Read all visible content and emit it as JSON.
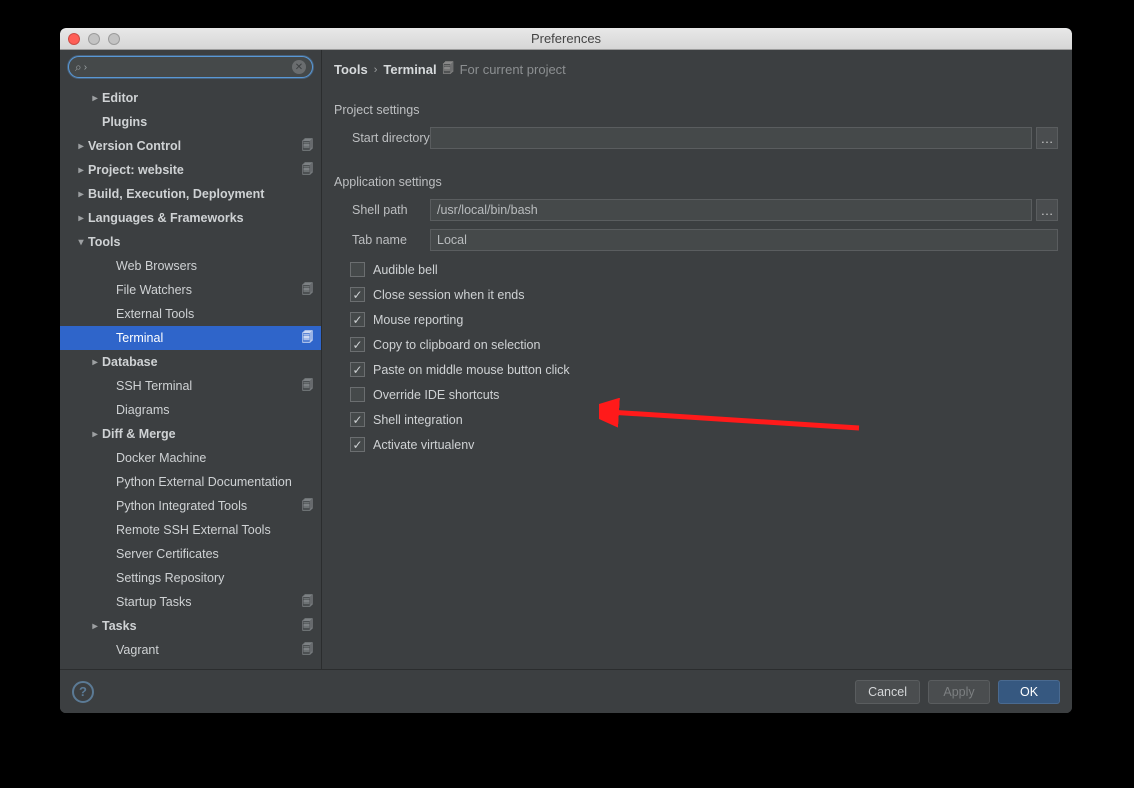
{
  "window": {
    "title": "Preferences"
  },
  "search": {
    "placeholder": ""
  },
  "sidebar": {
    "items": [
      {
        "label": "Editor",
        "indent": 1,
        "twisty": "right",
        "badge": false
      },
      {
        "label": "Plugins",
        "indent": 1,
        "twisty": "",
        "badge": false
      },
      {
        "label": "Version Control",
        "indent": 0,
        "twisty": "right",
        "badge": true
      },
      {
        "label": "Project: website",
        "indent": 0,
        "twisty": "right",
        "badge": true
      },
      {
        "label": "Build, Execution, Deployment",
        "indent": 0,
        "twisty": "right",
        "badge": false
      },
      {
        "label": "Languages & Frameworks",
        "indent": 0,
        "twisty": "right",
        "badge": false
      },
      {
        "label": "Tools",
        "indent": 0,
        "twisty": "down",
        "badge": false
      },
      {
        "label": "Web Browsers",
        "indent": 2,
        "twisty": "",
        "badge": false,
        "child": true
      },
      {
        "label": "File Watchers",
        "indent": 2,
        "twisty": "",
        "badge": true,
        "child": true
      },
      {
        "label": "External Tools",
        "indent": 2,
        "twisty": "",
        "badge": false,
        "child": true
      },
      {
        "label": "Terminal",
        "indent": 2,
        "twisty": "",
        "badge": true,
        "selected": true,
        "child": true
      },
      {
        "label": "Database",
        "indent": 1,
        "twisty": "right",
        "badge": false
      },
      {
        "label": "SSH Terminal",
        "indent": 2,
        "twisty": "",
        "badge": true,
        "child": true
      },
      {
        "label": "Diagrams",
        "indent": 2,
        "twisty": "",
        "badge": false,
        "child": true
      },
      {
        "label": "Diff & Merge",
        "indent": 1,
        "twisty": "right",
        "badge": false
      },
      {
        "label": "Docker Machine",
        "indent": 2,
        "twisty": "",
        "badge": false,
        "child": true
      },
      {
        "label": "Python External Documentation",
        "indent": 2,
        "twisty": "",
        "badge": false,
        "child": true
      },
      {
        "label": "Python Integrated Tools",
        "indent": 2,
        "twisty": "",
        "badge": true,
        "child": true
      },
      {
        "label": "Remote SSH External Tools",
        "indent": 2,
        "twisty": "",
        "badge": false,
        "child": true
      },
      {
        "label": "Server Certificates",
        "indent": 2,
        "twisty": "",
        "badge": false,
        "child": true
      },
      {
        "label": "Settings Repository",
        "indent": 2,
        "twisty": "",
        "badge": false,
        "child": true
      },
      {
        "label": "Startup Tasks",
        "indent": 2,
        "twisty": "",
        "badge": true,
        "child": true
      },
      {
        "label": "Tasks",
        "indent": 1,
        "twisty": "right",
        "badge": true
      },
      {
        "label": "Vagrant",
        "indent": 2,
        "twisty": "",
        "badge": true,
        "child": true
      }
    ]
  },
  "breadcrumb": {
    "root": "Tools",
    "leaf": "Terminal",
    "scope": "For current project"
  },
  "project_settings": {
    "heading": "Project settings",
    "start_directory_label": "Start directory",
    "start_directory_value": ""
  },
  "app_settings": {
    "heading": "Application settings",
    "shell_path_label": "Shell path",
    "shell_path_value": "/usr/local/bin/bash",
    "tab_name_label": "Tab name",
    "tab_name_value": "Local",
    "checkboxes": [
      {
        "label": "Audible bell",
        "checked": false
      },
      {
        "label": "Close session when it ends",
        "checked": true
      },
      {
        "label": "Mouse reporting",
        "checked": true
      },
      {
        "label": "Copy to clipboard on selection",
        "checked": true
      },
      {
        "label": "Paste on middle mouse button click",
        "checked": true
      },
      {
        "label": "Override IDE shortcuts",
        "checked": false
      },
      {
        "label": "Shell integration",
        "checked": true
      },
      {
        "label": "Activate virtualenv",
        "checked": true
      }
    ]
  },
  "footer": {
    "cancel": "Cancel",
    "apply": "Apply",
    "ok": "OK"
  }
}
